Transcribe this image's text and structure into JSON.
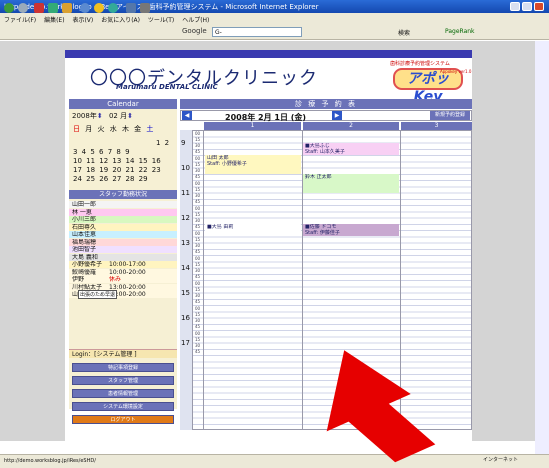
{
  "browser": {
    "title": "http://demo.worksblog.jp - iRes(アイリス) 歯科予約管理システム - Microsoft Internet Explorer",
    "menu": [
      "ファイル(F)",
      "編集(E)",
      "表示(V)",
      "お気に入り(A)",
      "ツール(T)",
      "ヘルプ(H)"
    ],
    "search_engine": "Google",
    "search_box": "G-",
    "search_btn": "検索",
    "pagerank": "PageRank",
    "status_url": "http://demo.worksblog.jp/iRes/eSHD/",
    "zone": "インターネット"
  },
  "clinic": {
    "name": "〇〇〇デンタルクリニック",
    "name_en": "Marumaru DENTAL CLINIC",
    "product": "アポッKey",
    "product_sub": "歯科診療予約管理システム",
    "version": "Appokey ver1.0"
  },
  "calendar": {
    "title": "Calendar",
    "year": "2008年",
    "month": "02 月",
    "dow": [
      "日",
      "月",
      "火",
      "水",
      "木",
      "金",
      "土"
    ],
    "weeks": [
      "1 2",
      "3 4 5 6 7 8 9",
      "10 11 12 13 14 15 16",
      "17 18 19 20 21 22 23",
      "24 25 26 27 28 29"
    ]
  },
  "staff": {
    "title": "スタッフ勤務状況",
    "rows": [
      {
        "name": "山田一郎",
        "bg": "#f4f4f4",
        "hours": ""
      },
      {
        "name": "林 一恵",
        "bg": "#ffc8f0",
        "hours": ""
      },
      {
        "name": "小川三郎",
        "bg": "#d8f8c0",
        "hours": ""
      },
      {
        "name": "石田尊久",
        "bg": "#fff4c0",
        "hours": ""
      },
      {
        "name": "山本佳恵",
        "bg": "#c8f0ff",
        "hours": ""
      },
      {
        "name": "福島瑞穂",
        "bg": "#ffd8d8",
        "hours": ""
      },
      {
        "name": "池田智子",
        "bg": "#f0e0ff",
        "hours": ""
      },
      {
        "name": "大島 義和",
        "bg": "#e4e4e4",
        "hours": ""
      },
      {
        "name": "小野優希子",
        "bg": "#fff4c0",
        "hours": "10:00-17:00"
      },
      {
        "name": "鮫崎優羅",
        "bg": "#fff8e0",
        "hours": "10:00-20:00"
      },
      {
        "name": "伊野",
        "bg": "#fff8e0",
        "hours": "休み"
      },
      {
        "name": "川村鮎太子",
        "bg": "#fff8e0",
        "hours": "13:00-20:00"
      },
      {
        "name": "山本久美子",
        "bg": "#fff8e0",
        "hours": "10:00-20:00"
      }
    ],
    "tooltip": "出張のため早退"
  },
  "login": "Login：[システム管理 ]",
  "menu_buttons": [
    "特記事項登録",
    "スタッフ管理",
    "患者情報管理",
    "システム環境設定",
    "ログアウト"
  ],
  "schedule": {
    "title": "診 療 予 約 表",
    "date": "2008年 2月 1日 (金)",
    "prev": "◀",
    "next": "▶",
    "new_res": "新規予約登録",
    "columns": [
      "1",
      "2",
      "3"
    ],
    "hours": [
      "9",
      "10",
      "11",
      "12",
      "13",
      "14",
      "15",
      "16",
      "17"
    ],
    "minutes": [
      "00",
      "15",
      "30",
      "45"
    ],
    "appointments": [
      {
        "col": 1,
        "start": 9.5,
        "end": 10.0,
        "bg": "#f8d0f4",
        "line1": "■大島ふじ",
        "line2": "Staff: 山本久美子"
      },
      {
        "col": 0,
        "start": 10.0,
        "end": 10.75,
        "bg": "#fff8c0",
        "line1": "山田 太郎",
        "line2": "Staff: 小野優希子"
      },
      {
        "col": 1,
        "start": 10.75,
        "end": 11.5,
        "bg": "#d8f8c8",
        "line1": "鈴木 正太郎",
        "line2": ""
      },
      {
        "col": 0,
        "start": 12.75,
        "end": 13.25,
        "bg": "#ffffff",
        "line1": "■大島 由莉",
        "line2": ""
      },
      {
        "col": 1,
        "start": 12.75,
        "end": 13.25,
        "bg": "#c8a8d0",
        "line1": "■佐藤 ドコモ",
        "line2": "Staff: 伊藤佳子"
      }
    ]
  }
}
